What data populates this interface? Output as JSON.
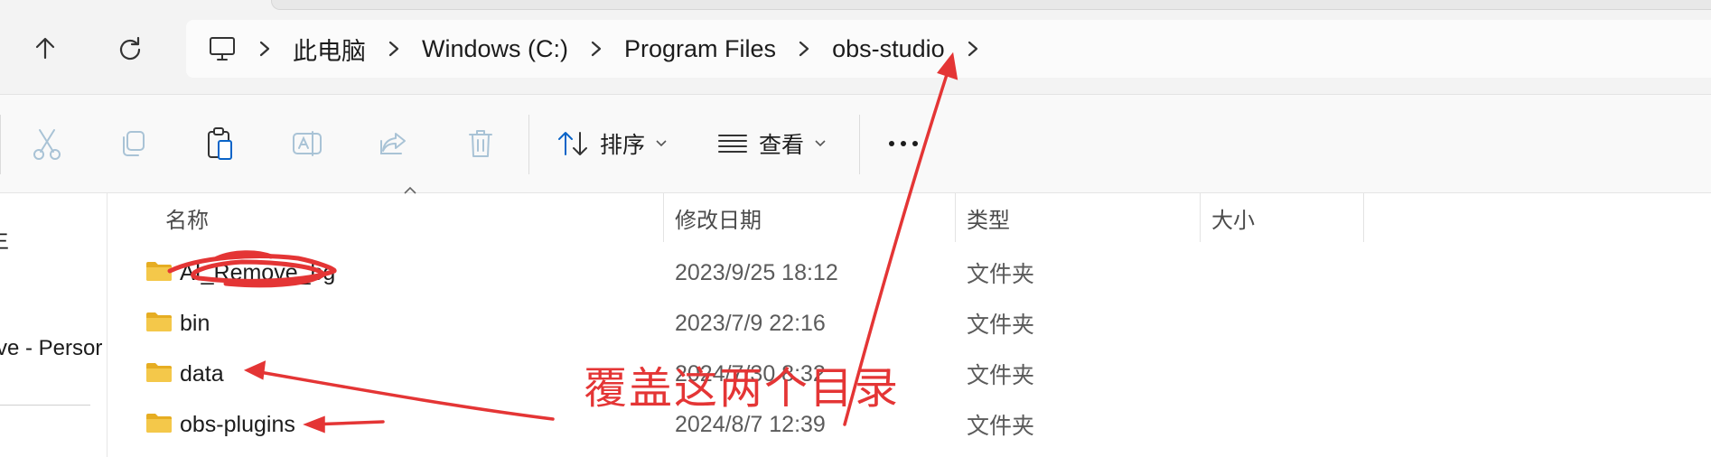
{
  "breadcrumb": [
    "此电脑",
    "Windows (C:)",
    "Program Files",
    "obs-studio"
  ],
  "toolbar": {
    "icons": [
      "cut-icon",
      "copy-icon",
      "paste-icon",
      "rename-icon",
      "share-icon",
      "delete-icon"
    ],
    "sort_label": "排序",
    "view_label": "查看",
    "more_label": "···"
  },
  "sidebar": {
    "item_top_fragment": "生",
    "item_mid_fragment": "ve - Persor"
  },
  "columns": {
    "name": "名称",
    "modified": "修改日期",
    "type": "类型",
    "size": "大小"
  },
  "files": [
    {
      "name": "AI_Remove_bg",
      "modified": "2023/9/25 18:12",
      "type": "文件夹",
      "scribbled": true
    },
    {
      "name": "bin",
      "modified": "2023/7/9 22:16",
      "type": "文件夹",
      "scribbled": false
    },
    {
      "name": "data",
      "modified": "2024/7/30 8:32",
      "type": "文件夹",
      "scribbled": false
    },
    {
      "name": "obs-plugins",
      "modified": "2024/8/7 12:39",
      "type": "文件夹",
      "scribbled": false
    }
  ],
  "annotation": {
    "text": "覆盖这两个目录",
    "color": "#e43535"
  },
  "colors": {
    "folder": "#f4c84a",
    "folder_dark": "#e6ad22",
    "icon_muted": "#a9c3d6",
    "accent": "#0a64c8"
  }
}
